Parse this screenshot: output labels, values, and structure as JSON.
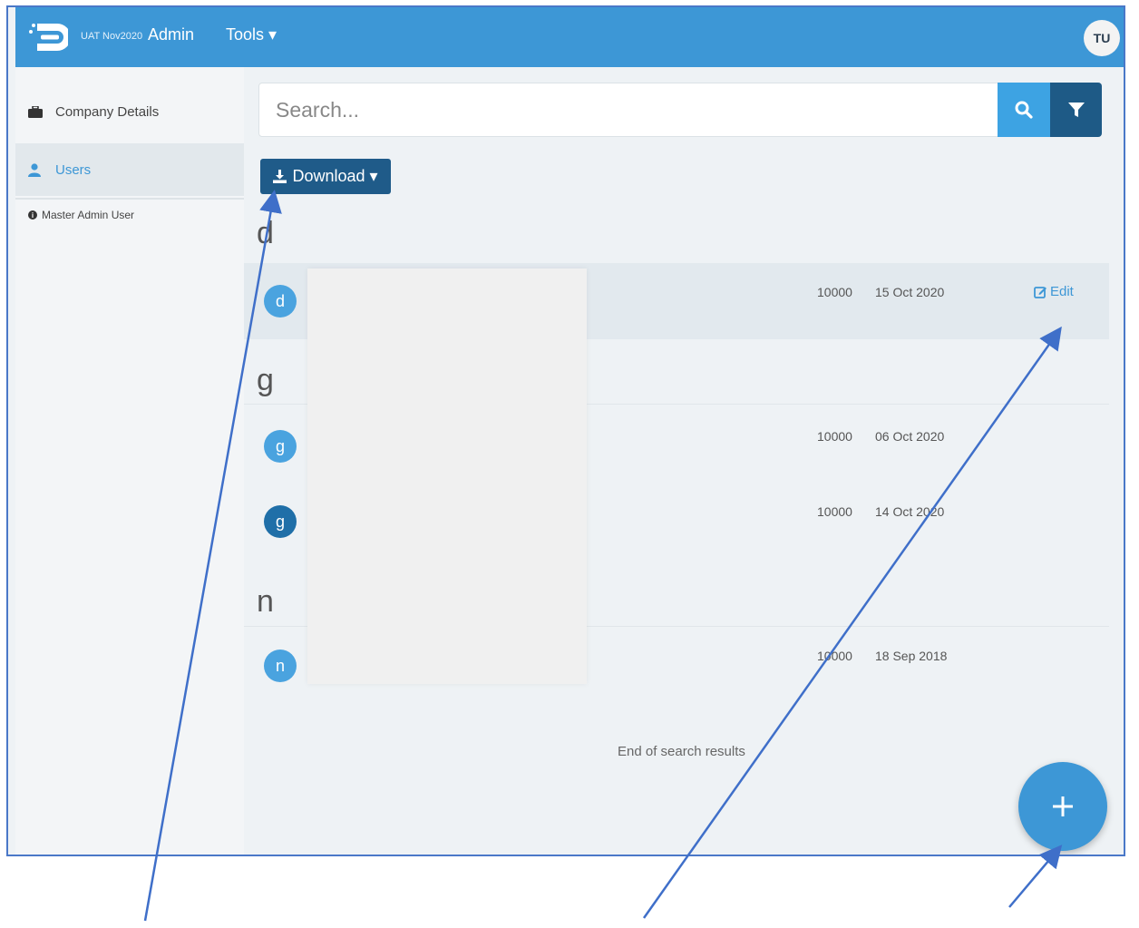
{
  "header": {
    "environment": "UAT Nov2020",
    "app_name": "Admin",
    "tools_menu": "Tools ▾",
    "user_initials": "TU"
  },
  "sidebar": {
    "items": [
      {
        "label": "Company Details",
        "icon": "briefcase-icon"
      },
      {
        "label": "Users",
        "icon": "user-icon",
        "active": true
      }
    ],
    "footer": "Master Admin User"
  },
  "search": {
    "placeholder": "Search..."
  },
  "toolbar": {
    "download_label": "Download ▾"
  },
  "groups": [
    {
      "letter": "d",
      "users": [
        {
          "initial": "d",
          "count": "10000",
          "date": "15 Oct 2020",
          "edit_label": "Edit",
          "avatar_color": "#4aa3df"
        }
      ]
    },
    {
      "letter": "g",
      "users": [
        {
          "initial": "g",
          "count": "10000",
          "date": "06 Oct 2020",
          "avatar_color": "#4aa3df"
        },
        {
          "initial": "g",
          "count": "10000",
          "date": "14 Oct 2020",
          "avatar_color": "#1f6fa8"
        }
      ]
    },
    {
      "letter": "n",
      "users": [
        {
          "initial": "n",
          "count": "10000",
          "date": "18 Sep 2018",
          "avatar_color": "#4aa3df"
        }
      ]
    }
  ],
  "end_of_results": "End of search results",
  "colors": {
    "topbar": "#3d97d6",
    "accent": "#3d97d6",
    "dark_button": "#1f5b89",
    "annotation_arrow": "#3f6fc9"
  }
}
